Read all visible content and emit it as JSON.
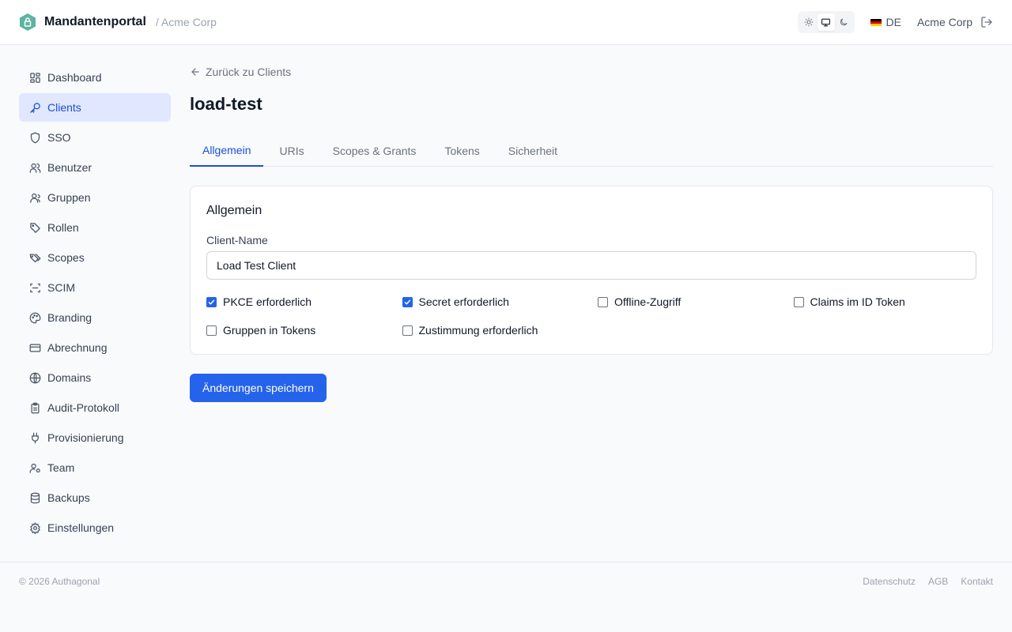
{
  "header": {
    "app_name": "Mandantenportal",
    "tenant": "/ Acme Corp",
    "language": "DE",
    "org_name": "Acme Corp",
    "theme_options": [
      "light",
      "system",
      "dark"
    ],
    "theme_active": "system"
  },
  "sidebar": {
    "items": [
      {
        "label": "Dashboard",
        "icon": "dashboard-icon"
      },
      {
        "label": "Clients",
        "icon": "key-icon",
        "active": true
      },
      {
        "label": "SSO",
        "icon": "shield-icon"
      },
      {
        "label": "Benutzer",
        "icon": "users-icon"
      },
      {
        "label": "Gruppen",
        "icon": "group-icon"
      },
      {
        "label": "Rollen",
        "icon": "tag-icon"
      },
      {
        "label": "Scopes",
        "icon": "tags-icon"
      },
      {
        "label": "SCIM",
        "icon": "scan-icon"
      },
      {
        "label": "Branding",
        "icon": "palette-icon"
      },
      {
        "label": "Abrechnung",
        "icon": "credit-card-icon"
      },
      {
        "label": "Domains",
        "icon": "globe-icon"
      },
      {
        "label": "Audit-Protokoll",
        "icon": "clipboard-icon"
      },
      {
        "label": "Provisionierung",
        "icon": "plug-icon"
      },
      {
        "label": "Team",
        "icon": "user-cog-icon"
      },
      {
        "label": "Backups",
        "icon": "database-icon"
      },
      {
        "label": "Einstellungen",
        "icon": "gear-icon"
      }
    ]
  },
  "main": {
    "back_link": "Zurück zu Clients",
    "title": "load-test",
    "tabs": [
      {
        "label": "Allgemein",
        "active": true
      },
      {
        "label": "URIs"
      },
      {
        "label": "Scopes & Grants"
      },
      {
        "label": "Tokens"
      },
      {
        "label": "Sicherheit"
      }
    ],
    "card": {
      "title": "Allgemein",
      "client_name_label": "Client-Name",
      "client_name_value": "Load Test Client",
      "checkboxes": [
        {
          "label": "PKCE erforderlich",
          "checked": true
        },
        {
          "label": "Secret erforderlich",
          "checked": true
        },
        {
          "label": "Offline-Zugriff",
          "checked": false
        },
        {
          "label": "Claims im ID Token",
          "checked": false
        },
        {
          "label": "Gruppen in Tokens",
          "checked": false
        },
        {
          "label": "Zustimmung erforderlich",
          "checked": false
        }
      ]
    },
    "save_label": "Änderungen speichern"
  },
  "footer": {
    "copyright": "© 2026 Authagonal",
    "links": [
      "Datenschutz",
      "AGB",
      "Kontakt"
    ]
  },
  "colors": {
    "accent": "#2563eb",
    "active_nav_bg": "#e0e7ff",
    "logo": "#5fb3a3"
  }
}
